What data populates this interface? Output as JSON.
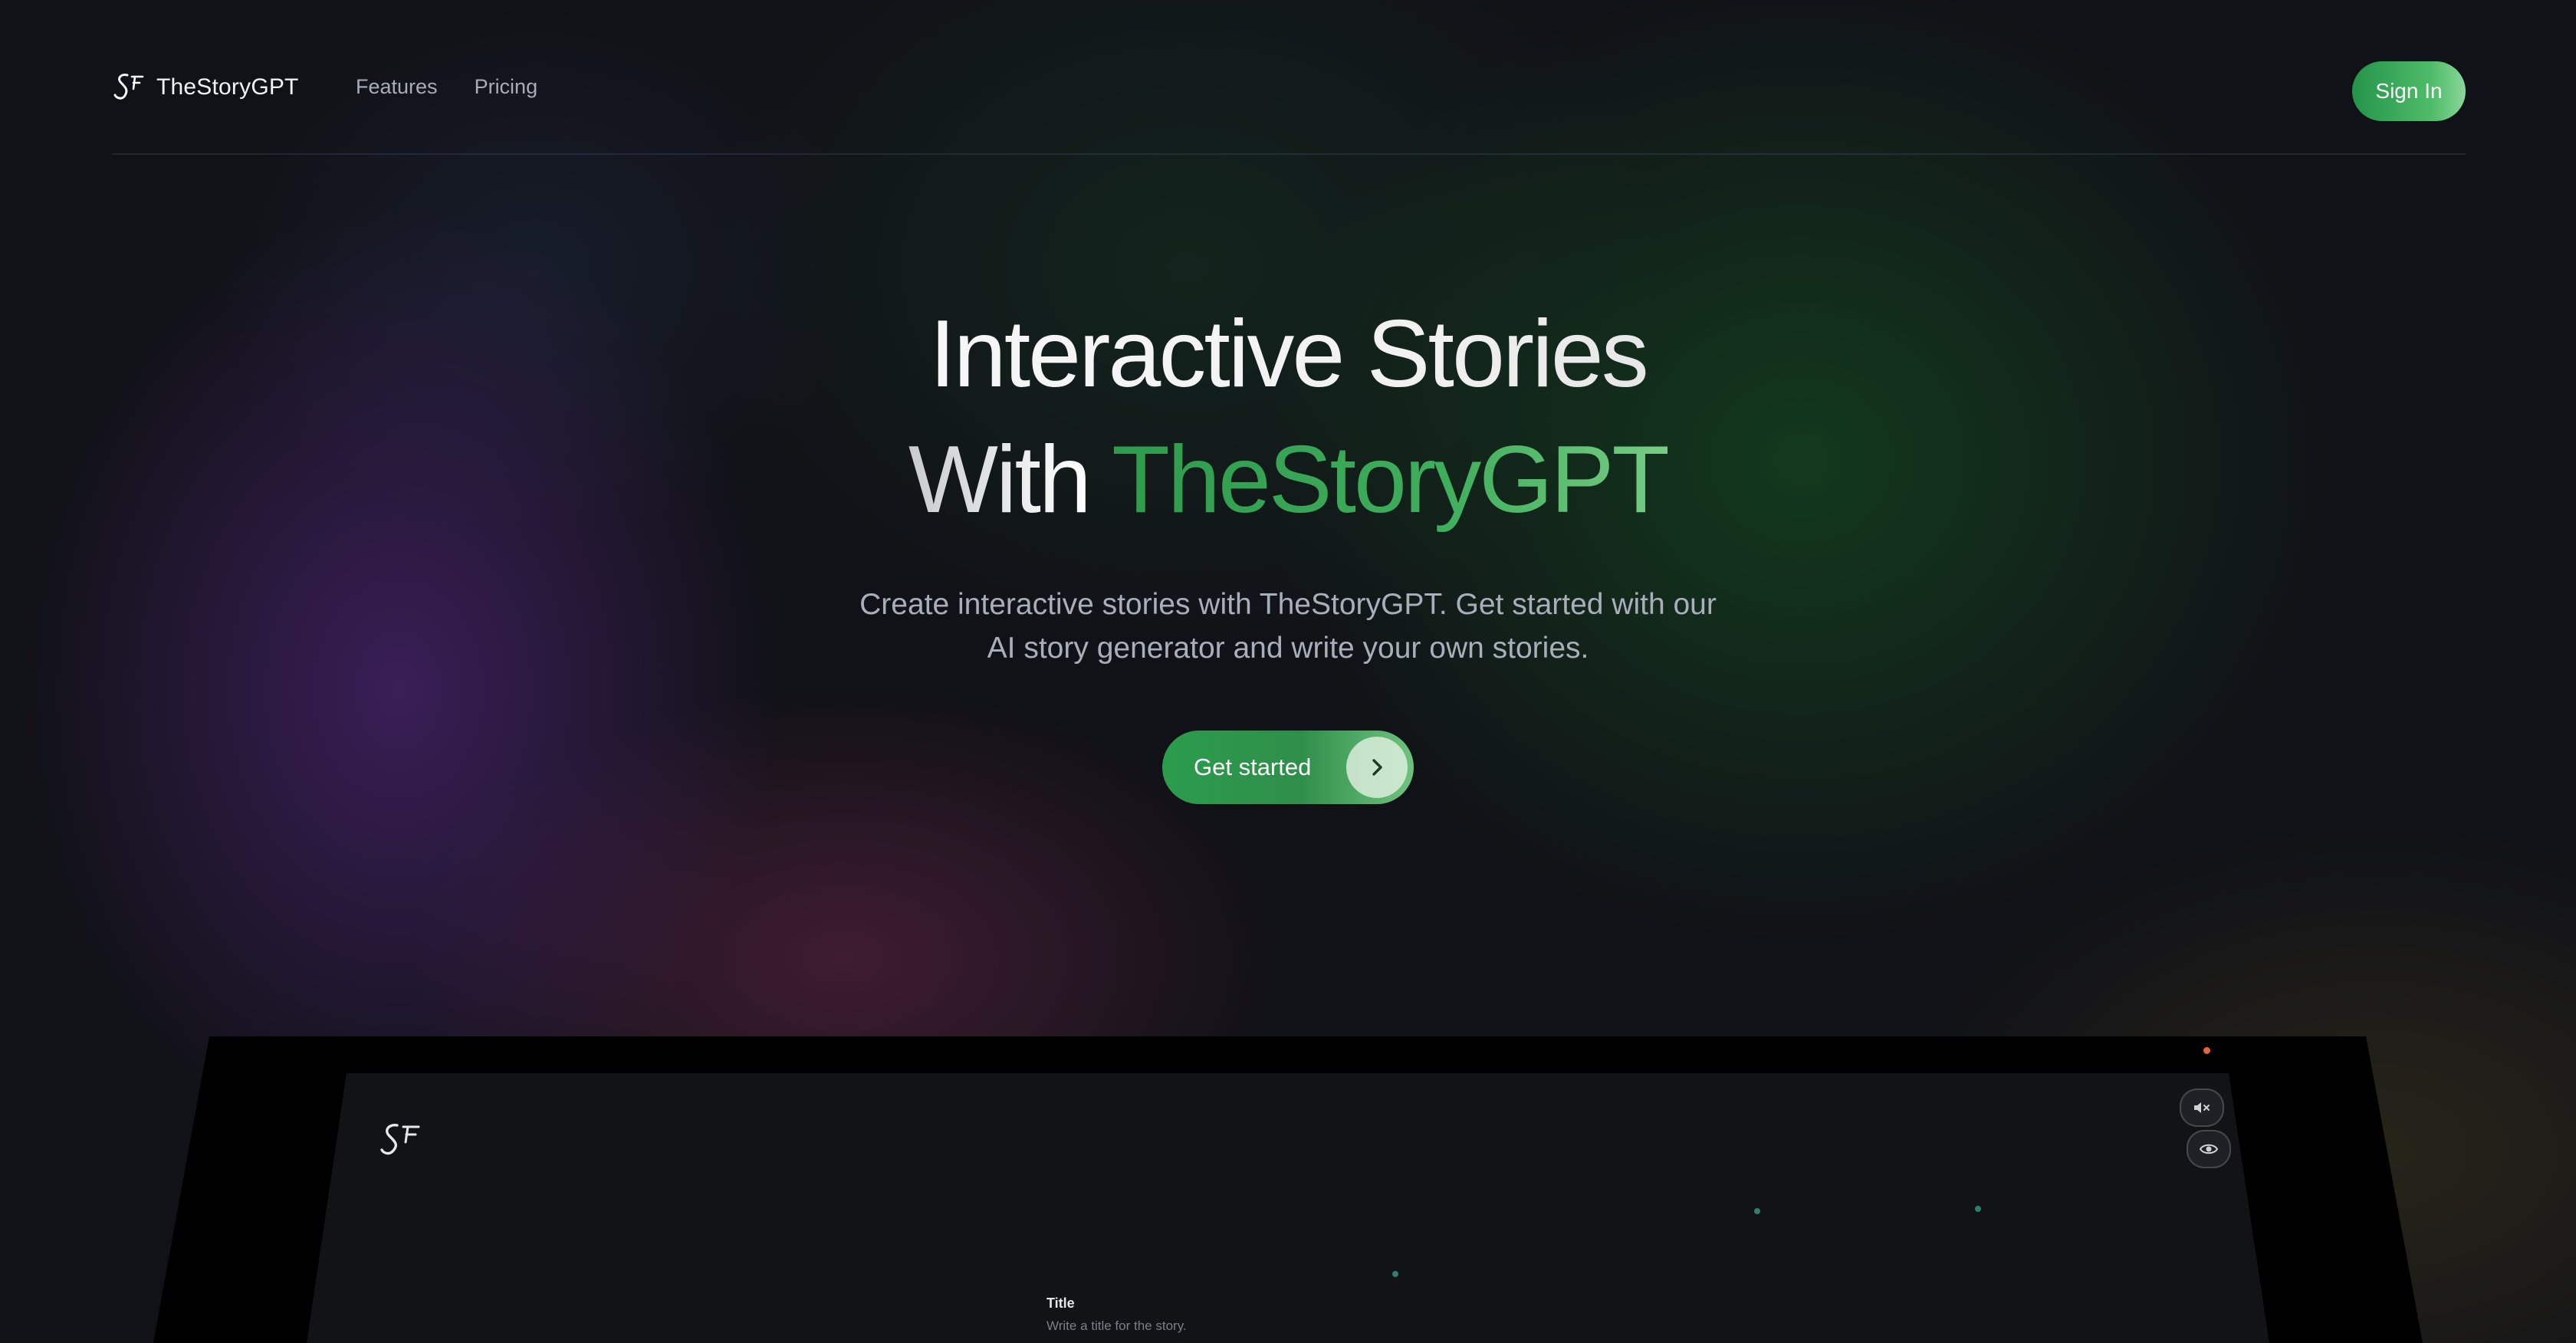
{
  "header": {
    "brand": "TheStoryGPT",
    "nav": [
      {
        "label": "Features"
      },
      {
        "label": "Pricing"
      }
    ],
    "signin_label": "Sign In"
  },
  "hero": {
    "line1": "Interactive Stories",
    "line2_prefix": "With",
    "line2_brand": "TheStoryGPT",
    "subtitle_line1": "Create interactive stories with TheStoryGPT. Get started with our",
    "subtitle_line2": "AI story generator and write your own stories.",
    "cta_label": "Get started",
    "cta_icon": "chevron-right-icon"
  },
  "preview": {
    "field_title": "Title",
    "field_placeholder": "Write a title for the story.",
    "icons": [
      "logo-icon",
      "speaker-muted-icon",
      "eye-icon"
    ]
  },
  "colors": {
    "accent_green": "#2f9a4d",
    "accent_green_light": "#78cc85",
    "background": "#111217",
    "muted_text": "#a9afba"
  }
}
